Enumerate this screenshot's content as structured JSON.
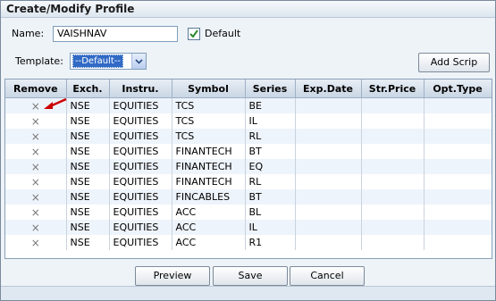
{
  "title": "Create/Modify Profile",
  "name_label": "Name:",
  "name_value": "VAISHNAV",
  "default_label": "Default",
  "default_checked": true,
  "template_label": "Template:",
  "template_value": "--Default--",
  "add_scrip_label": "Add Scrip",
  "columns": [
    "Remove",
    "Exch.",
    "Instru.",
    "Symbol",
    "Series",
    "Exp.Date",
    "Str.Price",
    "Opt.Type"
  ],
  "rows": [
    {
      "remove": "×",
      "exch": "NSE",
      "instru": "EQUITIES",
      "symbol": "TCS",
      "series": "BE",
      "exp_date": "",
      "str_price": "",
      "opt_type": ""
    },
    {
      "remove": "×",
      "exch": "NSE",
      "instru": "EQUITIES",
      "symbol": "TCS",
      "series": "IL",
      "exp_date": "",
      "str_price": "",
      "opt_type": ""
    },
    {
      "remove": "×",
      "exch": "NSE",
      "instru": "EQUITIES",
      "symbol": "TCS",
      "series": "RL",
      "exp_date": "",
      "str_price": "",
      "opt_type": ""
    },
    {
      "remove": "×",
      "exch": "NSE",
      "instru": "EQUITIES",
      "symbol": "FINANTECH",
      "series": "BT",
      "exp_date": "",
      "str_price": "",
      "opt_type": ""
    },
    {
      "remove": "×",
      "exch": "NSE",
      "instru": "EQUITIES",
      "symbol": "FINANTECH",
      "series": "EQ",
      "exp_date": "",
      "str_price": "",
      "opt_type": ""
    },
    {
      "remove": "×",
      "exch": "NSE",
      "instru": "EQUITIES",
      "symbol": "FINANTECH",
      "series": "RL",
      "exp_date": "",
      "str_price": "",
      "opt_type": ""
    },
    {
      "remove": "×",
      "exch": "NSE",
      "instru": "EQUITIES",
      "symbol": "FINCABLES",
      "series": "BT",
      "exp_date": "",
      "str_price": "",
      "opt_type": ""
    },
    {
      "remove": "×",
      "exch": "NSE",
      "instru": "EQUITIES",
      "symbol": "ACC",
      "series": "BL",
      "exp_date": "",
      "str_price": "",
      "opt_type": ""
    },
    {
      "remove": "×",
      "exch": "NSE",
      "instru": "EQUITIES",
      "symbol": "ACC",
      "series": "IL",
      "exp_date": "",
      "str_price": "",
      "opt_type": ""
    },
    {
      "remove": "×",
      "exch": "NSE",
      "instru": "EQUITIES",
      "symbol": "ACC",
      "series": "R1",
      "exp_date": "",
      "str_price": "",
      "opt_type": ""
    }
  ],
  "buttons": {
    "preview": "Preview",
    "save": "Save",
    "cancel": "Cancel"
  },
  "colors": {
    "row_alt": "#eef4fb",
    "header": "#c9d6e4",
    "pointer": "#cc0000"
  }
}
